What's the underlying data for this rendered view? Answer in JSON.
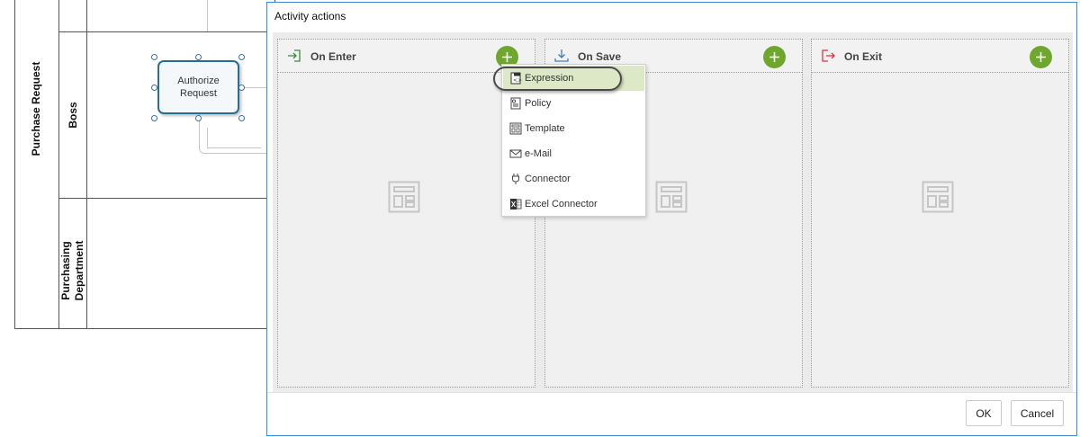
{
  "diagram": {
    "pool_label": "Purchase Request",
    "lanes": [
      {
        "label": "Boss"
      },
      {
        "label_line1": "Purchasing",
        "label_line2": "Department"
      }
    ],
    "task": {
      "label": "Authorize Request"
    }
  },
  "dialog": {
    "title": "Activity actions",
    "panels": [
      {
        "title": "On Enter",
        "icon": "enter-icon",
        "icon_color": "#3c8a3c"
      },
      {
        "title": "On Save",
        "icon": "save-download-icon",
        "icon_color": "#3b7dc4"
      },
      {
        "title": "On Exit",
        "icon": "exit-icon",
        "icon_color": "#d9363e"
      }
    ],
    "add_button_symbol": "+",
    "ok_label": "OK",
    "cancel_label": "Cancel"
  },
  "menu": {
    "items": [
      {
        "label": "Expression",
        "icon": "expression-icon",
        "active": true
      },
      {
        "label": "Policy",
        "icon": "policy-icon"
      },
      {
        "label": "Template",
        "icon": "template-icon"
      },
      {
        "label": "e-Mail",
        "icon": "email-icon"
      },
      {
        "label": "Connector",
        "icon": "connector-plug-icon"
      },
      {
        "label": "Excel Connector",
        "icon": "excel-icon"
      }
    ]
  },
  "colors": {
    "accent_green": "#6fa72e",
    "menu_highlight": "#dde8c6",
    "dialog_border": "#3b8bd0",
    "task_border": "#2a6f8f"
  }
}
